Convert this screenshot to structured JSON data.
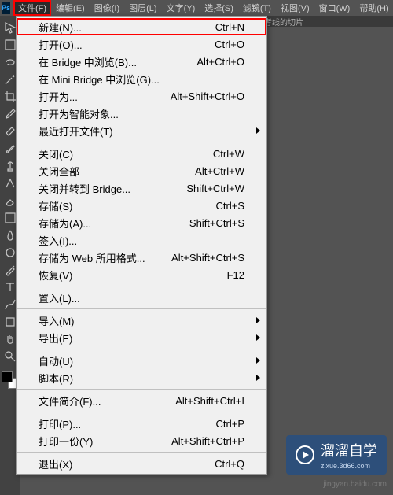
{
  "app": {
    "logo": "Ps"
  },
  "menubar": [
    {
      "label": "文件(F)",
      "active": true
    },
    {
      "label": "编辑(E)"
    },
    {
      "label": "图像(I)"
    },
    {
      "label": "图层(L)"
    },
    {
      "label": "文字(Y)"
    },
    {
      "label": "选择(S)"
    },
    {
      "label": "滤镜(T)"
    },
    {
      "label": "视图(V)"
    },
    {
      "label": "窗口(W)"
    },
    {
      "label": "帮助(H)"
    }
  ],
  "optionsBar": {
    "text": "考线的切片"
  },
  "menu": {
    "groups": [
      [
        {
          "label": "新建(N)...",
          "shortcut": "Ctrl+N",
          "highlighted": true
        },
        {
          "label": "打开(O)...",
          "shortcut": "Ctrl+O"
        },
        {
          "label": "在 Bridge 中浏览(B)...",
          "shortcut": "Alt+Ctrl+O"
        },
        {
          "label": "在 Mini Bridge 中浏览(G)..."
        },
        {
          "label": "打开为...",
          "shortcut": "Alt+Shift+Ctrl+O"
        },
        {
          "label": "打开为智能对象..."
        },
        {
          "label": "最近打开文件(T)",
          "submenu": true
        }
      ],
      [
        {
          "label": "关闭(C)",
          "shortcut": "Ctrl+W"
        },
        {
          "label": "关闭全部",
          "shortcut": "Alt+Ctrl+W"
        },
        {
          "label": "关闭并转到 Bridge...",
          "shortcut": "Shift+Ctrl+W"
        },
        {
          "label": "存储(S)",
          "shortcut": "Ctrl+S"
        },
        {
          "label": "存储为(A)...",
          "shortcut": "Shift+Ctrl+S"
        },
        {
          "label": "签入(I)..."
        },
        {
          "label": "存储为 Web 所用格式...",
          "shortcut": "Alt+Shift+Ctrl+S"
        },
        {
          "label": "恢复(V)",
          "shortcut": "F12"
        }
      ],
      [
        {
          "label": "置入(L)..."
        }
      ],
      [
        {
          "label": "导入(M)",
          "submenu": true
        },
        {
          "label": "导出(E)",
          "submenu": true
        }
      ],
      [
        {
          "label": "自动(U)",
          "submenu": true
        },
        {
          "label": "脚本(R)",
          "submenu": true
        }
      ],
      [
        {
          "label": "文件简介(F)...",
          "shortcut": "Alt+Shift+Ctrl+I"
        }
      ],
      [
        {
          "label": "打印(P)...",
          "shortcut": "Ctrl+P"
        },
        {
          "label": "打印一份(Y)",
          "shortcut": "Alt+Shift+Ctrl+P"
        }
      ],
      [
        {
          "label": "退出(X)",
          "shortcut": "Ctrl+Q"
        }
      ]
    ]
  },
  "tools": [
    "move",
    "marquee",
    "lasso",
    "wand",
    "crop",
    "eyedropper",
    "healing",
    "brush",
    "stamp",
    "history",
    "eraser",
    "gradient",
    "blur",
    "dodge",
    "pen",
    "type",
    "path",
    "shape",
    "hand",
    "zoom"
  ],
  "watermark": {
    "title": "溜溜自学",
    "sub": "zixue.3d66.com"
  },
  "jingyan": "jingyan.baidu.com"
}
